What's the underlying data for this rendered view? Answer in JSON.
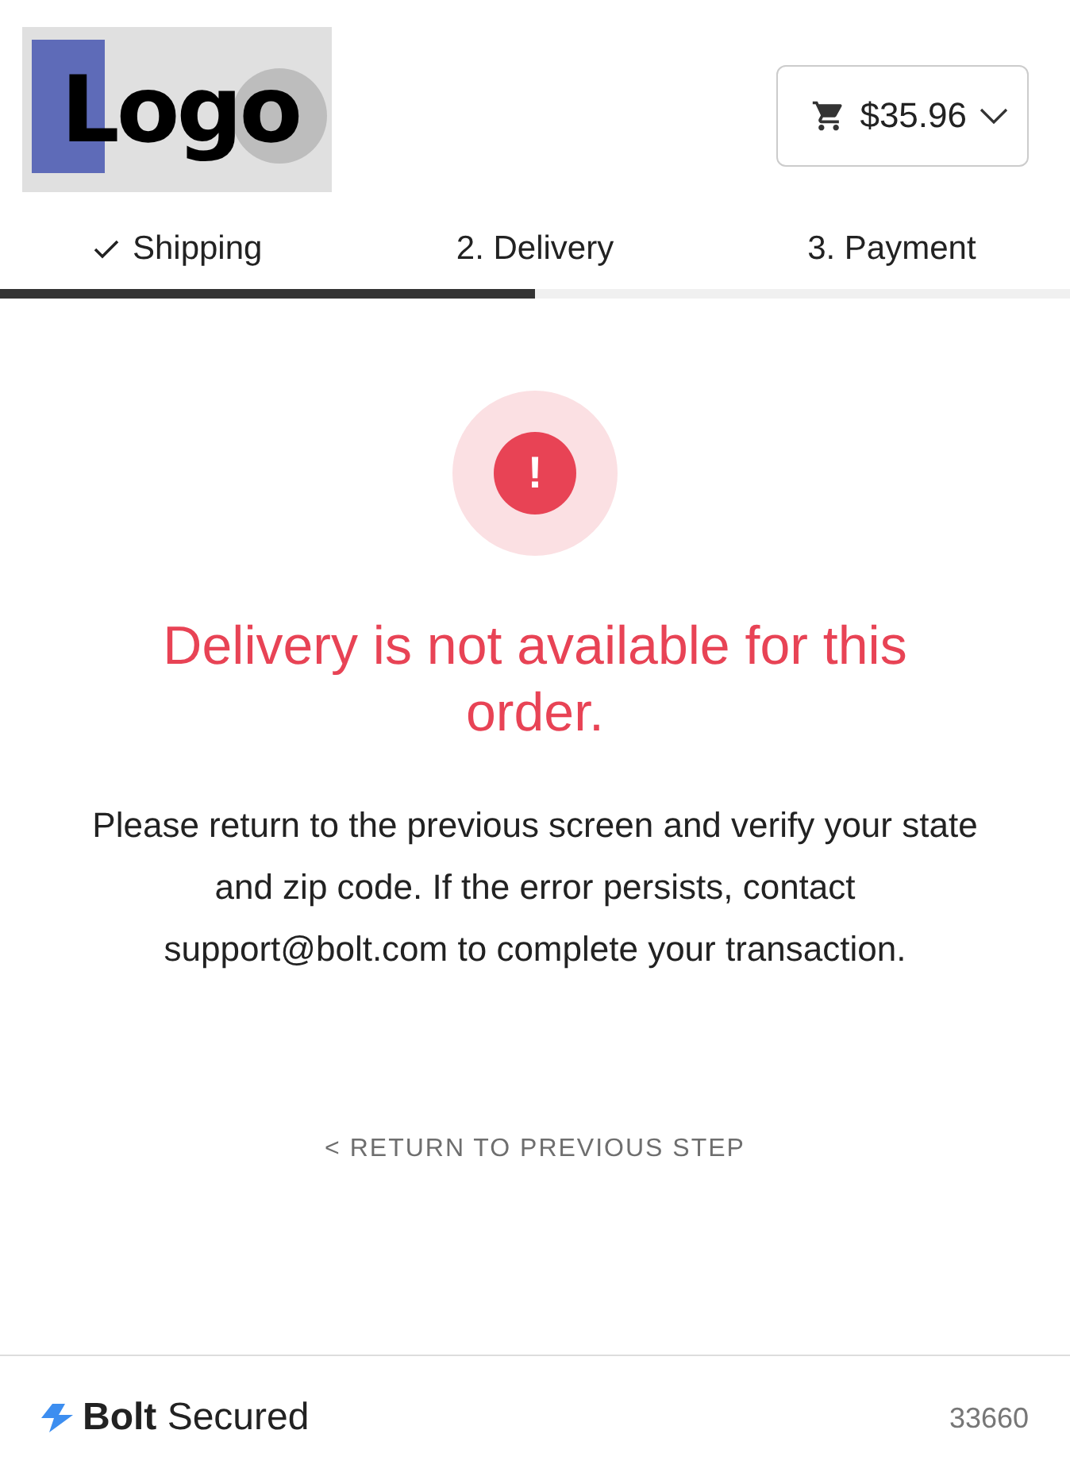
{
  "header": {
    "logo": "Logo",
    "cart_total": "$35.96"
  },
  "steps": [
    {
      "label": "Shipping",
      "completed": true
    },
    {
      "label": "2. Delivery",
      "completed": false
    },
    {
      "label": "3. Payment",
      "completed": false
    }
  ],
  "progress": {
    "level": 0.5
  },
  "error": {
    "icon": "!",
    "title": "Delivery is not available for this order.",
    "message": "Please return to the previous screen and verify your state and zip code. If the error persists, contact support@bolt.com to complete your transaction.",
    "link": "< RETURN TO PREVIOUS STEP"
  },
  "footer": {
    "brand": "**Bolt** Secured",
    "code": "33660"
  }
}
